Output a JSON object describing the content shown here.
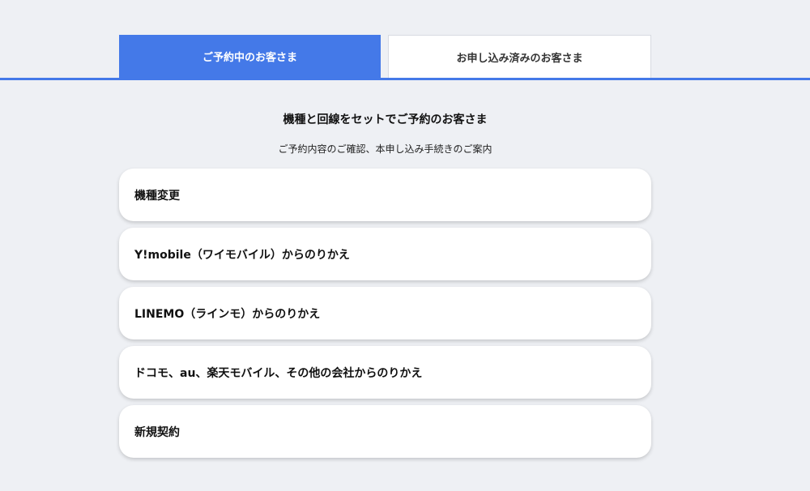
{
  "tabs": [
    {
      "label": "ご予約中のお客さま",
      "active": true
    },
    {
      "label": "お申し込み済みのお客さま",
      "active": false
    }
  ],
  "main": {
    "heading": "機種と回線をセットでご予約のお客さま",
    "subheading": "ご予約内容のご確認、本申し込み手続きのご案内",
    "options": [
      {
        "label": "機種変更"
      },
      {
        "label": "Y!mobile（ワイモバイル）からのりかえ"
      },
      {
        "label": "LINEMO（ラインモ）からのりかえ"
      },
      {
        "label": "ドコモ、au、楽天モバイル、その他の会社からのりかえ"
      },
      {
        "label": "新規契約"
      }
    ]
  },
  "colors": {
    "accent": "#4479e8",
    "background": "#eef0f4",
    "card": "#ffffff"
  }
}
